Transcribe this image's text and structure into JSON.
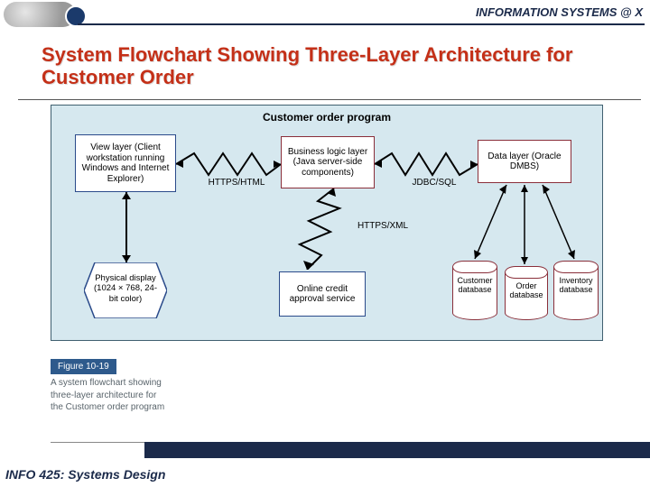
{
  "header": {
    "right": "INFORMATION SYSTEMS @ X"
  },
  "title": "System Flowchart Showing Three-Layer Architecture for Customer Order",
  "footer": "INFO 425: Systems Design",
  "figure": {
    "number": "Figure 10-19",
    "caption": "A system flowchart showing three-layer architecture for the Customer order program"
  },
  "diagram": {
    "title": "Customer order program",
    "nodes": {
      "view": "View layer\n(Client workstation running Windows and Internet Explorer)",
      "business": "Business logic layer\n(Java server-side components)",
      "data": "Data layer\n(Oracle DMBS)",
      "display": "Physical display (1024 × 768, 24-bit color)",
      "credit": "Online credit approval service"
    },
    "labels": {
      "https_html": "HTTPS/HTML",
      "https_xml": "HTTPS/XML",
      "jdbc_sql": "JDBC/SQL"
    },
    "databases": {
      "customer": "Customer database",
      "order": "Order database",
      "inventory": "Inventory database"
    }
  }
}
